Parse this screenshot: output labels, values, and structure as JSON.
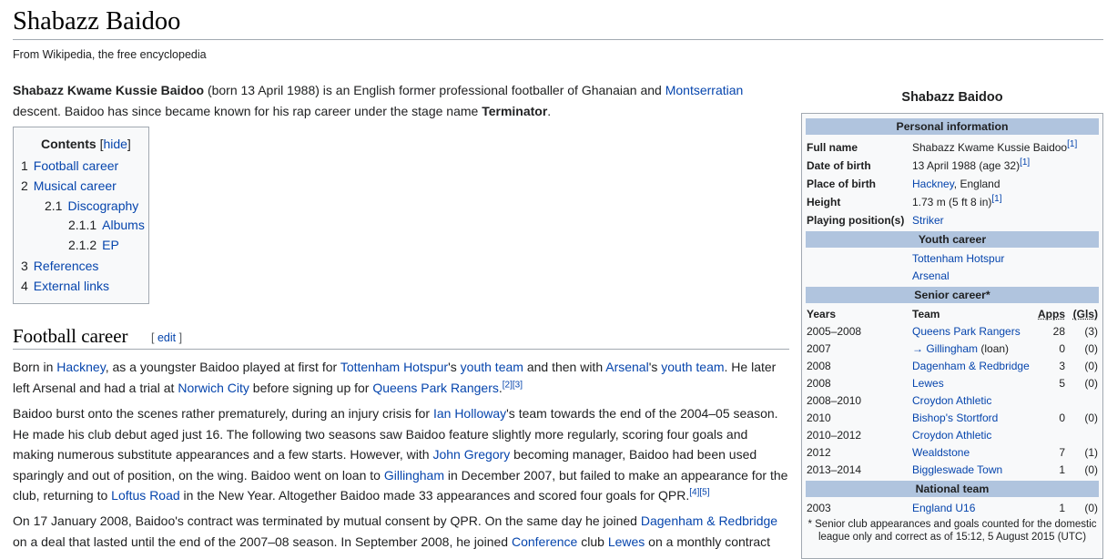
{
  "article": {
    "title": "Shabazz Baidoo",
    "tagline": "From Wikipedia, the free encyclopedia"
  },
  "lead": {
    "name_bold": "Shabazz Kwame Kussie Baidoo",
    "t1": " (born 13 April 1988) is an English former professional footballer of Ghanaian and ",
    "link1": "Montserratian",
    "t2": " descent. Baidoo has since became known for his rap career under the stage name ",
    "stage_name": "Terminator",
    "t3": "."
  },
  "toc": {
    "title": "Contents",
    "hide": "hide",
    "items": [
      {
        "num": "1",
        "label": "Football career"
      },
      {
        "num": "2",
        "label": "Musical career"
      },
      {
        "num": "2.1",
        "label": "Discography"
      },
      {
        "num": "2.1.1",
        "label": "Albums"
      },
      {
        "num": "2.1.2",
        "label": "EP"
      },
      {
        "num": "3",
        "label": "References"
      },
      {
        "num": "4",
        "label": "External links"
      }
    ]
  },
  "section": {
    "heading": "Football career",
    "edit": "edit"
  },
  "p1": {
    "a": "Born in ",
    "l1": "Hackney",
    "b": ", as a youngster Baidoo played at first for ",
    "l2": "Tottenham Hotspur",
    "c": "'s ",
    "l3": "youth team",
    "d": " and then with ",
    "l4": "Arsenal",
    "e": "'s ",
    "l5": "youth team",
    "f": ". He later left Arsenal and had a trial at ",
    "l6": "Norwich City",
    "g": " before signing up for ",
    "l7": "Queens Park Rangers",
    "h": ".",
    "ref": "[2][3]"
  },
  "p2": {
    "a": "Baidoo burst onto the scenes rather prematurely, during an injury crisis for ",
    "l1": "Ian Holloway",
    "b": "'s team towards the end of the 2004–05 season. He made his club debut aged just 16. The following two seasons saw Baidoo feature slightly more regularly, scoring four goals and making numerous substitute appearances and a few starts. However, with ",
    "l2": "John Gregory",
    "c": " becoming manager, Baidoo had been used sparingly and out of position, on the wing. Baidoo went on loan to ",
    "l3": "Gillingham",
    "d": " in December 2007, but failed to make an appearance for the club, returning to ",
    "l4": "Loftus Road",
    "e": " in the New Year. Altogether Baidoo made 33 appearances and scored four goals for QPR.",
    "ref": "[4][5]"
  },
  "p3": {
    "a": "On 17 January 2008, Baidoo's contract was terminated by mutual consent by QPR. On the same day he joined ",
    "l1": "Dagenham & Redbridge",
    "b": " on a deal that lasted until the end of the 2007–08 season. In September 2008, he joined ",
    "l2": "Conference",
    "c": " club ",
    "l3": "Lewes",
    "d": " on a monthly contract"
  },
  "infobox": {
    "title": "Shabazz Baidoo",
    "personal_head": "Personal information",
    "personal": [
      {
        "label": "Full name",
        "value": "Shabazz Kwame Kussie Baidoo",
        "ref": "[1]",
        "link": false
      },
      {
        "label": "Date of birth",
        "value": "13 April 1988 (age 32)",
        "ref": "[1]",
        "link": false
      },
      {
        "label": "Place of birth",
        "value_link": "Hackney",
        "value_rest": ", England"
      },
      {
        "label": "Height",
        "value": "1.73 m (5 ft 8 in)",
        "ref": "[1]",
        "link": false
      },
      {
        "label": "Playing position(s)",
        "value_link": "Striker"
      }
    ],
    "youth_head": "Youth career",
    "youth": [
      "Tottenham Hotspur",
      "Arsenal"
    ],
    "senior_head": "Senior career*",
    "col_years": "Years",
    "col_team": "Team",
    "col_apps": "Apps",
    "col_gls": "(Gls)",
    "senior": [
      {
        "years": "2005–2008",
        "team": "Queens Park Rangers",
        "apps": "28",
        "gls": "(3)"
      },
      {
        "years": "2007",
        "team": "→ Gillingham",
        "suffix": " (loan)",
        "apps": "0",
        "gls": "(0)"
      },
      {
        "years": "2008",
        "team": "Dagenham & Redbridge",
        "apps": "3",
        "gls": "(0)"
      },
      {
        "years": "2008",
        "team": "Lewes",
        "apps": "5",
        "gls": "(0)"
      },
      {
        "years": "2008–2010",
        "team": "Croydon Athletic",
        "apps": "",
        "gls": ""
      },
      {
        "years": "2010",
        "team": "Bishop's Stortford",
        "apps": "0",
        "gls": "(0)"
      },
      {
        "years": "2010–2012",
        "team": "Croydon Athletic",
        "apps": "",
        "gls": ""
      },
      {
        "years": "2012",
        "team": "Wealdstone",
        "apps": "7",
        "gls": "(1)"
      },
      {
        "years": "2013–2014",
        "team": "Biggleswade Town",
        "apps": "1",
        "gls": "(0)"
      }
    ],
    "national_head": "National team",
    "national": [
      {
        "years": "2003",
        "team": "England U16",
        "apps": "1",
        "gls": "(0)"
      }
    ],
    "footnote": "* Senior club appearances and goals counted for the domestic league only and correct as of 15:12, 5 August 2015 (UTC)"
  }
}
